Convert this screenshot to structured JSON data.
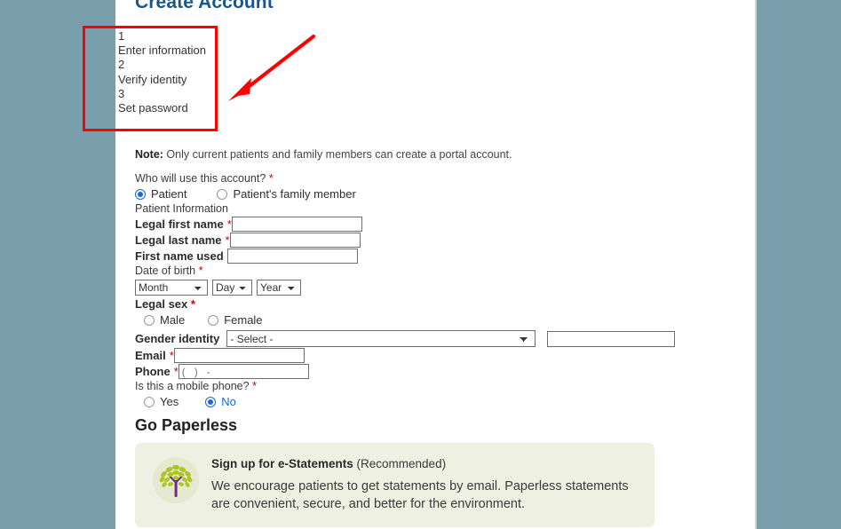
{
  "page": {
    "title": "Create Account",
    "title_color": "#15578f",
    "sidebar_color": "#789fab"
  },
  "steps": [
    {
      "number": "1",
      "label": "Enter information"
    },
    {
      "number": "2",
      "label": "Verify identity"
    },
    {
      "number": "3",
      "label": "Set password"
    }
  ],
  "form": {
    "note_prefix": "Note:",
    "note_text": " Only current patients and family members can create a portal account.",
    "who_question": "Who will use this account?",
    "who_options": [
      {
        "label": "Patient",
        "selected": true
      },
      {
        "label": "Patient's family member",
        "selected": false
      }
    ],
    "patient_information_heading": "Patient Information",
    "legal_first_name_label": "Legal first name",
    "legal_first_name_value": "",
    "legal_last_name_label": "Legal last name",
    "legal_last_name_value": "",
    "first_name_used_label": "First name used",
    "first_name_used_value": "",
    "date_of_birth_label": "Date of birth",
    "dob_month": "Month",
    "dob_day": "Day",
    "dob_year": "Year",
    "legal_sex_label": "Legal sex",
    "legal_sex_options": [
      {
        "label": "Male",
        "selected": false
      },
      {
        "label": "Female",
        "selected": false
      }
    ],
    "gender_identity_label": "Gender identity",
    "gender_identity_value": "- Select -",
    "gender_identity_free_text": "",
    "email_label": "Email",
    "email_value": "",
    "phone_label": "Phone",
    "phone_placeholder": "(   )   -",
    "mobile_question": "Is this a mobile phone?",
    "mobile_options": [
      {
        "label": "Yes",
        "selected": false
      },
      {
        "label": "No",
        "selected": true
      }
    ],
    "required_marker": "*"
  },
  "paperless": {
    "heading": "Go Paperless",
    "card_icon": "tree-icon",
    "card_title": "Sign up for e-Statements",
    "card_title_suffix": "(Recommended)",
    "card_body": "We encourage patients to get statements by email. Paperless statements are convenient, secure, and better for the environment.",
    "card_bg": "#eef0e1"
  },
  "annotations": {
    "highlight_color": "#ff0000",
    "box_target": "steps-list",
    "arrow_points_to": "steps-list"
  }
}
